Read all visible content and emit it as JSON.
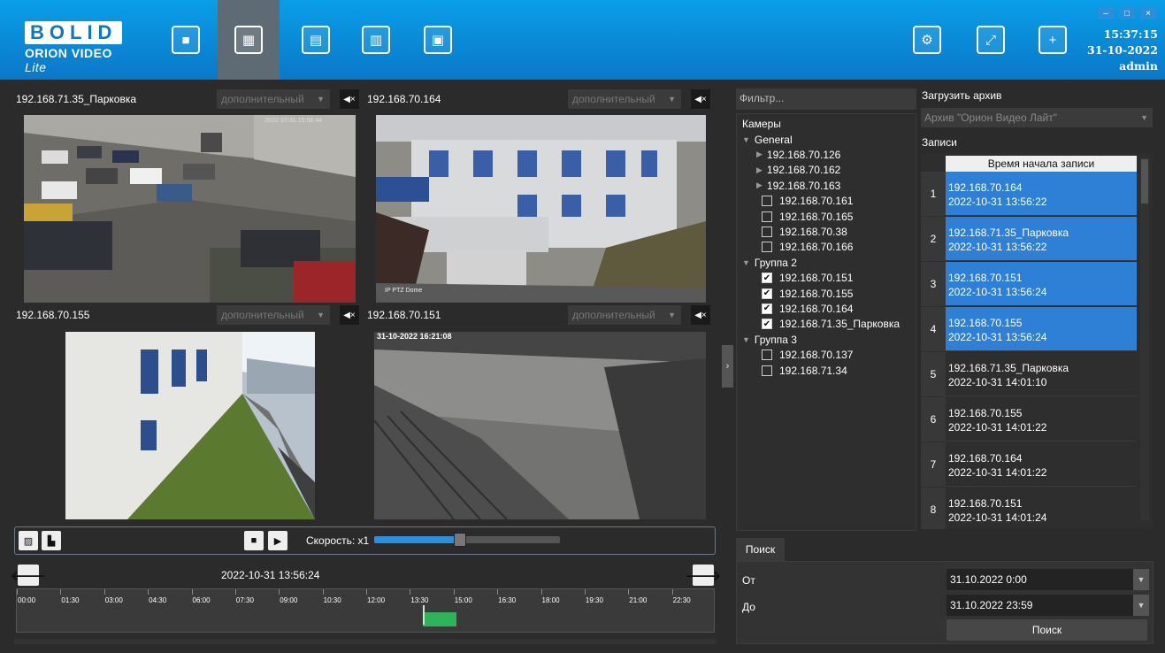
{
  "brand": {
    "logo_text": "BOLID",
    "product": "ORION VIDEO",
    "product_suffix": "Lite"
  },
  "header": {
    "time": "15:37:15",
    "date": "31-10-2022",
    "user": "admin"
  },
  "window_buttons": {
    "minimize": "–",
    "maximize": "□",
    "close": "×"
  },
  "toolbar": [
    {
      "name": "camera-icon",
      "glyph": "■"
    },
    {
      "name": "clapperboard-icon",
      "glyph": "▦"
    },
    {
      "name": "document-search-icon",
      "glyph": "▤"
    },
    {
      "name": "floorplan-icon",
      "glyph": "▥"
    },
    {
      "name": "grid-layout-icon",
      "glyph": "▣"
    }
  ],
  "toolbar_right": [
    {
      "name": "settings-icon",
      "glyph": "⚙"
    },
    {
      "name": "fullscreen-icon",
      "glyph": "⤢"
    },
    {
      "name": "add-window-icon",
      "glyph": "+"
    }
  ],
  "cameras": [
    {
      "title": "192.168.71.35_Парковка",
      "stream": "дополнительный",
      "overlay": "2022-10-31 15:56:44"
    },
    {
      "title": "192.168.70.164",
      "stream": "дополнительный",
      "overlay": "IP PTZ Dome"
    },
    {
      "title": "192.168.70.155",
      "stream": "дополнительный",
      "overlay": ""
    },
    {
      "title": "192.168.70.151",
      "stream": "дополнительный",
      "overlay": "31-10-2022 16:21:08"
    }
  ],
  "playback": {
    "speed_label": "Скорость: x1",
    "speed_fraction": 0.46,
    "timestamp": "2022-10-31 13:56:24"
  },
  "timeline": {
    "ticks": [
      "00:00",
      "01:30",
      "03:00",
      "04:30",
      "06:00",
      "07:30",
      "09:00",
      "10:30",
      "12:00",
      "13:30",
      "15:00",
      "16:30",
      "18:00",
      "19:30",
      "21:00",
      "22:30"
    ],
    "record_start_hour": 13.93,
    "record_end_hour": 15.1,
    "cursor_hour": 13.94
  },
  "tree": {
    "filter_placeholder": "Фильтр...",
    "header": "Камеры",
    "nodes": [
      {
        "label": "General",
        "type": "group"
      },
      {
        "label": "192.168.70.126",
        "type": "expandable"
      },
      {
        "label": "192.168.70.162",
        "type": "expandable"
      },
      {
        "label": "192.168.70.163",
        "type": "expandable"
      },
      {
        "label": "192.168.70.161",
        "type": "check",
        "checked": false
      },
      {
        "label": "192.168.70.165",
        "type": "check",
        "checked": false
      },
      {
        "label": "192.168.70.38",
        "type": "check",
        "checked": false
      },
      {
        "label": "192.168.70.166",
        "type": "check",
        "checked": false
      },
      {
        "label": "Группа 2",
        "type": "group"
      },
      {
        "label": "192.168.70.151",
        "type": "check",
        "checked": true
      },
      {
        "label": "192.168.70.155",
        "type": "check",
        "checked": true
      },
      {
        "label": "192.168.70.164",
        "type": "check",
        "checked": true
      },
      {
        "label": "192.168.71.35_Парковка",
        "type": "check",
        "checked": true
      },
      {
        "label": "Группа 3",
        "type": "group"
      },
      {
        "label": "192.168.70.137",
        "type": "check",
        "checked": false
      },
      {
        "label": "192.168.71.34",
        "type": "check",
        "checked": false
      }
    ]
  },
  "archive": {
    "load_label": "Загрузить архив",
    "selected": "Архив \"Орион Видео Лайт\"",
    "records_label": "Записи",
    "column": "Время начала записи"
  },
  "records": [
    {
      "n": "1",
      "camera": "192.168.70.164",
      "time": "2022-10-31 13:56:22",
      "selected": true
    },
    {
      "n": "2",
      "camera": "192.168.71.35_Парковка",
      "time": "2022-10-31 13:56:22",
      "selected": true
    },
    {
      "n": "3",
      "camera": "192.168.70.151",
      "time": "2022-10-31 13:56:24",
      "selected": true
    },
    {
      "n": "4",
      "camera": "192.168.70.155",
      "time": "2022-10-31 13:56:24",
      "selected": true
    },
    {
      "n": "5",
      "camera": "192.168.71.35_Парковка",
      "time": "2022-10-31 14:01:10",
      "selected": false
    },
    {
      "n": "6",
      "camera": "192.168.70.155",
      "time": "2022-10-31 14:01:22",
      "selected": false
    },
    {
      "n": "7",
      "camera": "192.168.70.164",
      "time": "2022-10-31 14:01:22",
      "selected": false
    },
    {
      "n": "8",
      "camera": "192.168.70.151",
      "time": "2022-10-31 14:01:24",
      "selected": false
    }
  ],
  "search": {
    "tab": "Поиск",
    "from_label": "От",
    "from_value": "31.10.2022 0:00",
    "to_label": "До",
    "to_value": "31.10.2022 23:59",
    "button": "Поиск"
  }
}
